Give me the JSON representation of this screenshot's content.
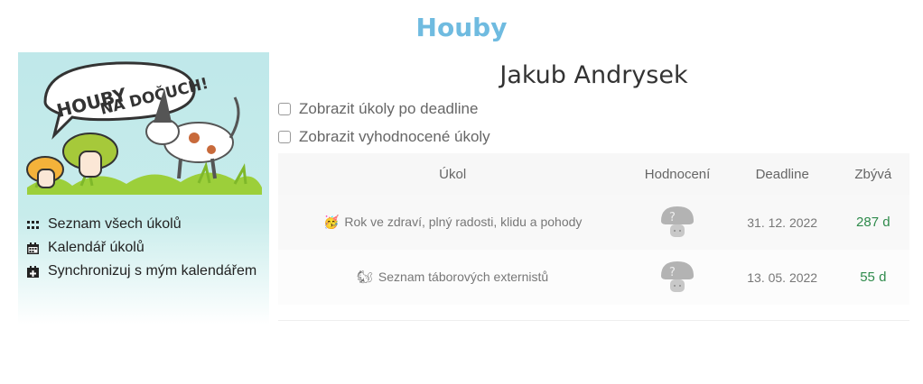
{
  "site": {
    "title": "Houby"
  },
  "sidebar": {
    "logo_text_line1": "HOUBY",
    "logo_text_line2": "NA DOČUCH!",
    "menu": [
      {
        "label": "Seznam všech úkolů",
        "icon": "grid-icon"
      },
      {
        "label": "Kalendář úkolů",
        "icon": "calendar-icon"
      },
      {
        "label": "Synchronizuj s mým kalendářem",
        "icon": "calendar-plus-icon"
      }
    ]
  },
  "main": {
    "user_name": "Jakub Andrysek",
    "filters": [
      {
        "label": "Zobrazit úkoly po deadline",
        "checked": false
      },
      {
        "label": "Zobrazit vyhodnocené úkoly",
        "checked": false
      }
    ],
    "table": {
      "headers": [
        "Úkol",
        "Hodnocení",
        "Deadline",
        "Zbývá"
      ],
      "rows": [
        {
          "emoji": "🥳",
          "task": "Rok ve zdraví, plný radosti, klidu a pohody",
          "deadline": "31. 12. 2022",
          "remaining": "287 d",
          "rating_icon": "mushroom-question-icon"
        },
        {
          "emoji": "🐿",
          "task": "Seznam táborových externistů",
          "deadline": "13. 05. 2022",
          "remaining": "55 d",
          "rating_icon": "mushroom-question-icon"
        }
      ]
    }
  },
  "colors": {
    "title": "#6fbbe0",
    "sidebar_bg": "#bfe8ea",
    "remaining_green": "#2e8a4b"
  }
}
